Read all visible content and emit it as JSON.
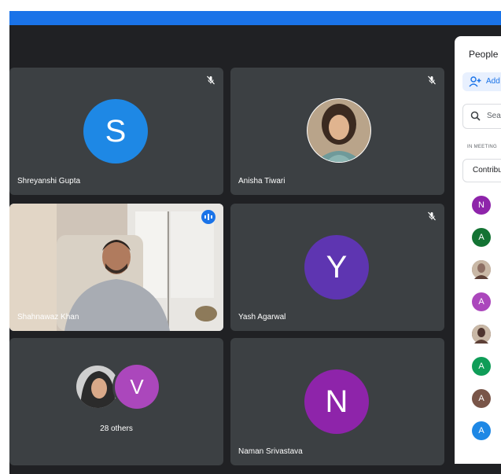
{
  "tiles": [
    {
      "name": "Shreyanshi Gupta",
      "initial": "S",
      "color": "#1e88e5",
      "muted": true
    },
    {
      "name": "Anisha Tiwari",
      "muted": true
    },
    {
      "name": "Shahnawaz Khan",
      "speaking": true
    },
    {
      "name": "Yash Agarwal",
      "initial": "Y",
      "color": "#5e35b1",
      "muted": true
    },
    {
      "others_label": "28 others",
      "initial": "V",
      "color": "#ab47bc"
    },
    {
      "name": "Naman Srivastava",
      "initial": "N",
      "color": "#8e24aa"
    }
  ],
  "panel": {
    "title": "People",
    "add_label": "Add people",
    "search_placeholder": "Search for people",
    "section_label": "IN MEETING",
    "group_label": "Contributors",
    "participants": [
      {
        "initial": "N",
        "color": "#8e24aa"
      },
      {
        "initial": "A",
        "color": "#137333"
      },
      {
        "photo": true,
        "color": "#8d6e63"
      },
      {
        "initial": "A",
        "color": "#ab47bc"
      },
      {
        "photo": true,
        "color": "#4e342e"
      },
      {
        "initial": "A",
        "color": "#0f9d58"
      },
      {
        "initial": "A",
        "color": "#795548"
      },
      {
        "initial": "A",
        "color": "#1e88e5"
      }
    ]
  }
}
